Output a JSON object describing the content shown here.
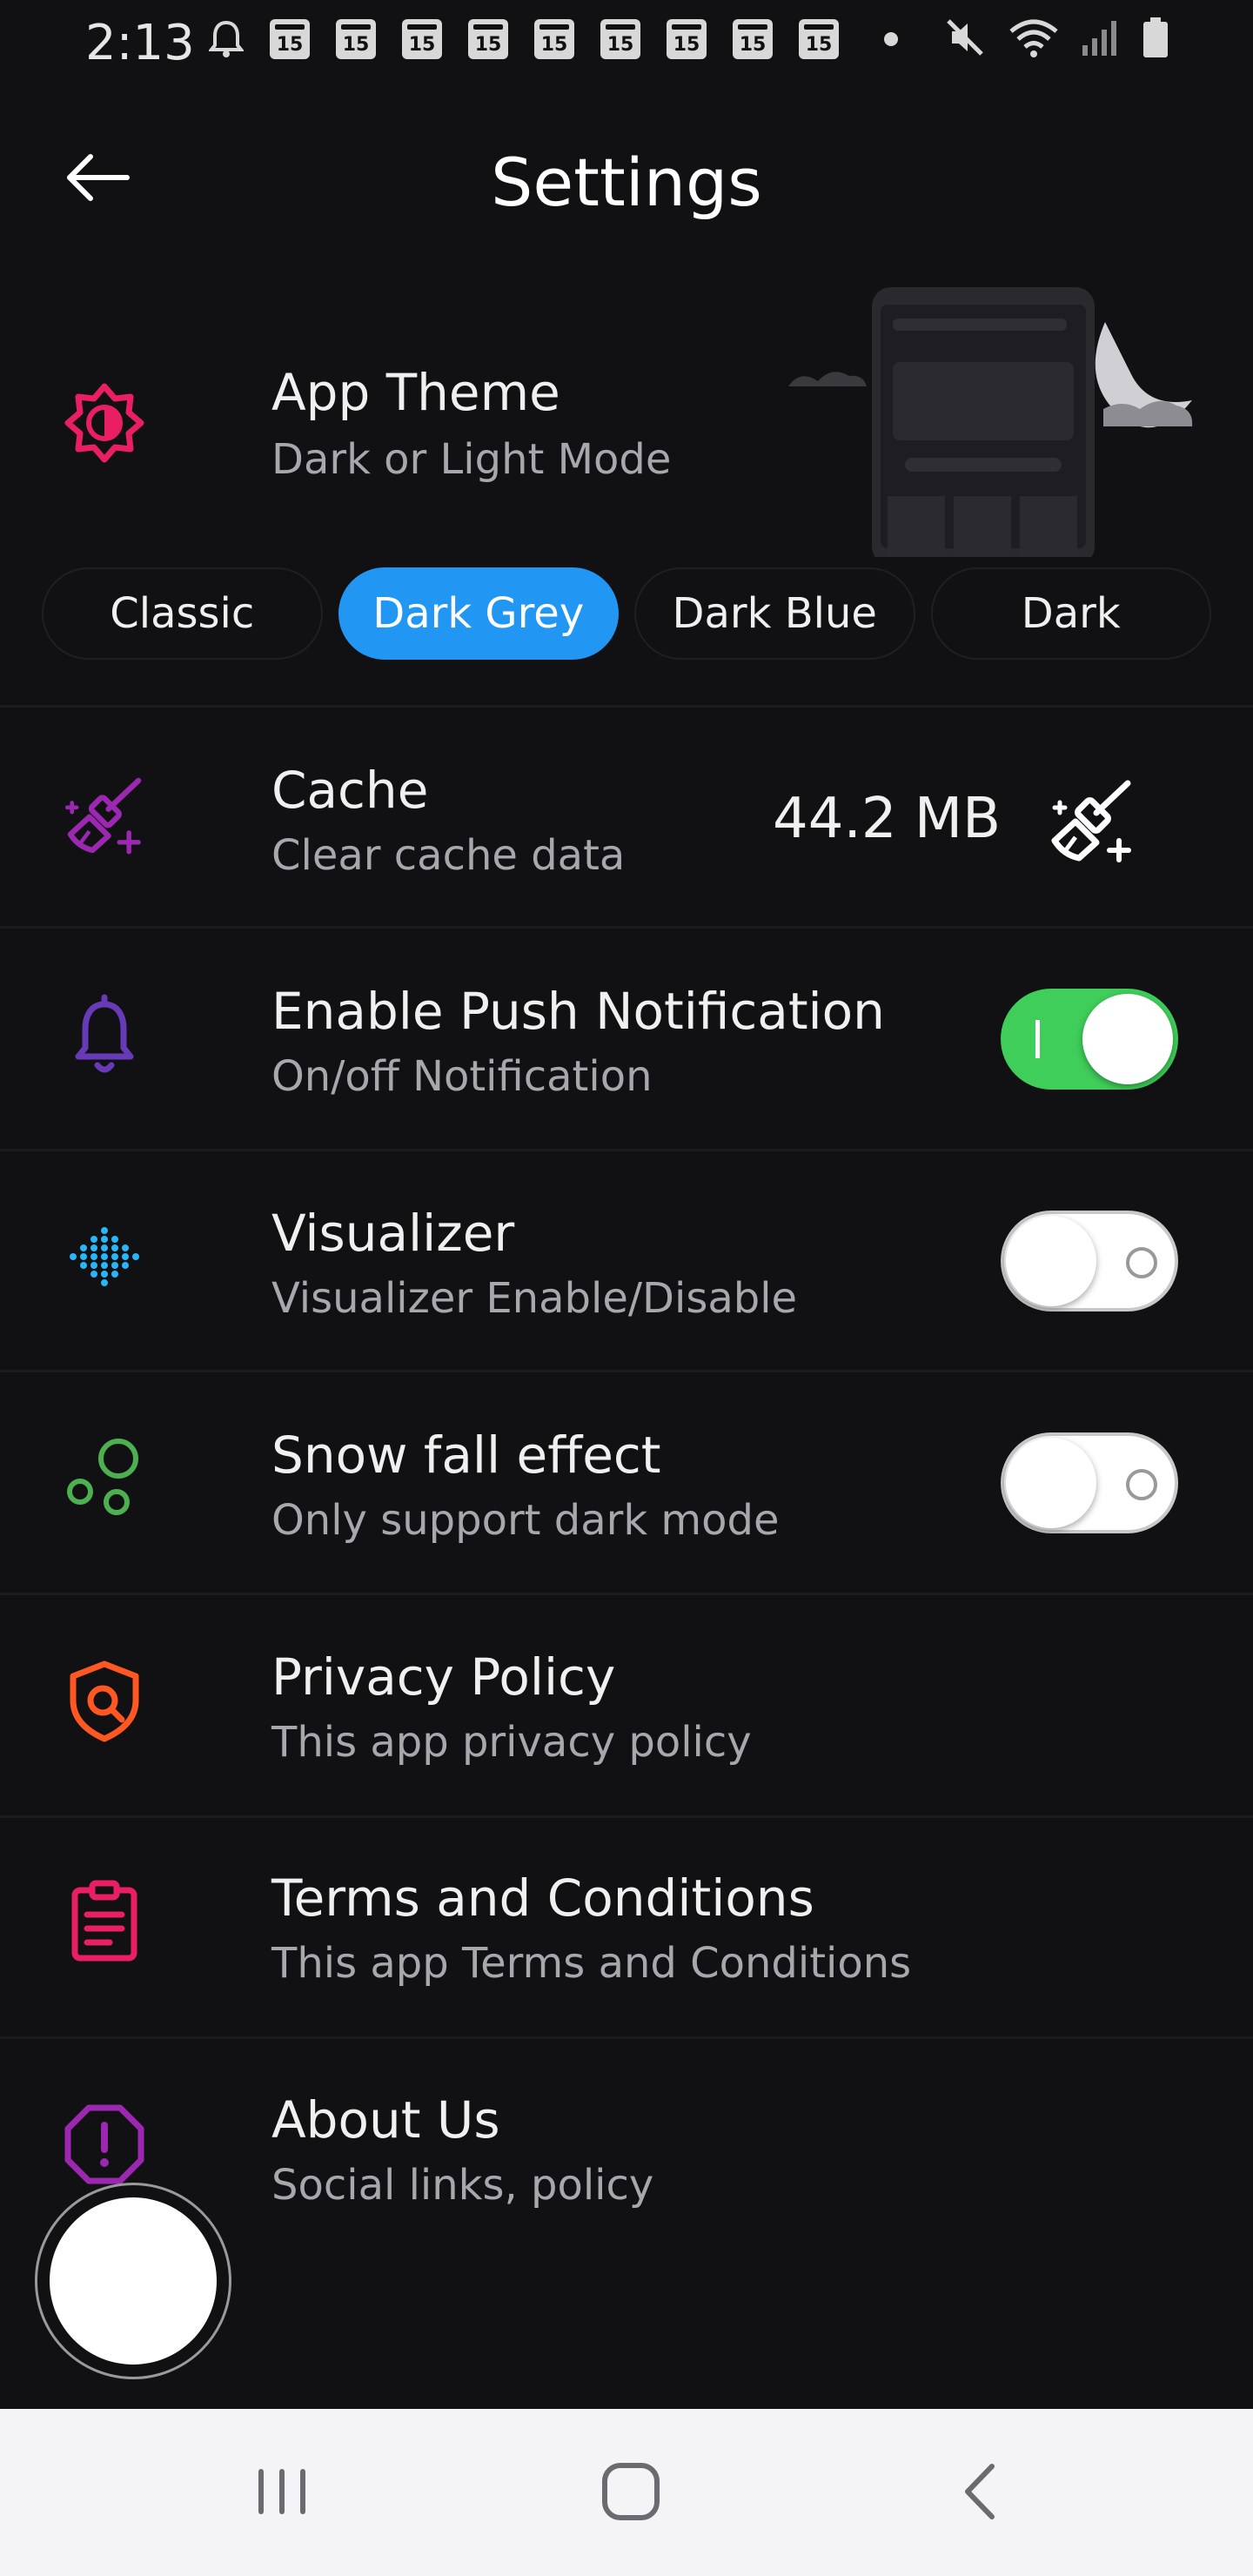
{
  "status_bar": {
    "time": "2:13",
    "calendar_badge": "15",
    "calendar_count": 9
  },
  "header": {
    "title": "Settings"
  },
  "theme": {
    "title": "App Theme",
    "subtitle": "Dark or Light Mode",
    "options": [
      "Classic",
      "Dark Grey",
      "Dark Blue",
      "Dark"
    ],
    "selected": "Dark Grey",
    "accent_color": "#2196f3"
  },
  "cache": {
    "title": "Cache",
    "subtitle": "Clear cache data",
    "size": "44.2 MB"
  },
  "push_notification": {
    "title": "Enable Push Notification",
    "subtitle": "On/off Notification",
    "enabled": true
  },
  "visualizer": {
    "title": "Visualizer",
    "subtitle": "Visualizer Enable/Disable",
    "enabled": false
  },
  "snow_fall": {
    "title": "Snow fall effect",
    "subtitle": "Only support dark mode",
    "enabled": false
  },
  "privacy": {
    "title": "Privacy Policy",
    "subtitle": "This app privacy policy"
  },
  "terms": {
    "title": "Terms and Conditions",
    "subtitle": "This app Terms and Conditions"
  },
  "about": {
    "title": "About Us",
    "subtitle": "Social links, policy"
  },
  "colors": {
    "background": "#111114",
    "toggle_on": "#3fce5a",
    "theme_icon": "#e91e63",
    "cache_icon": "#9c27b0",
    "bell_icon": "#673ab7",
    "visualizer_icon": "#29b6f6",
    "snow_icon": "#4caf50",
    "privacy_icon": "#ff5722",
    "terms_icon": "#e91e63",
    "about_icon": "#9c27b0"
  },
  "icons": {
    "theme": "brightness-icon",
    "cache": "broom-icon",
    "push": "bell-icon",
    "visualizer": "dot-matrix-icon",
    "snow": "bubbles-icon",
    "privacy": "shield-icon",
    "terms": "clipboard-icon",
    "about": "alert-octagon-icon"
  }
}
